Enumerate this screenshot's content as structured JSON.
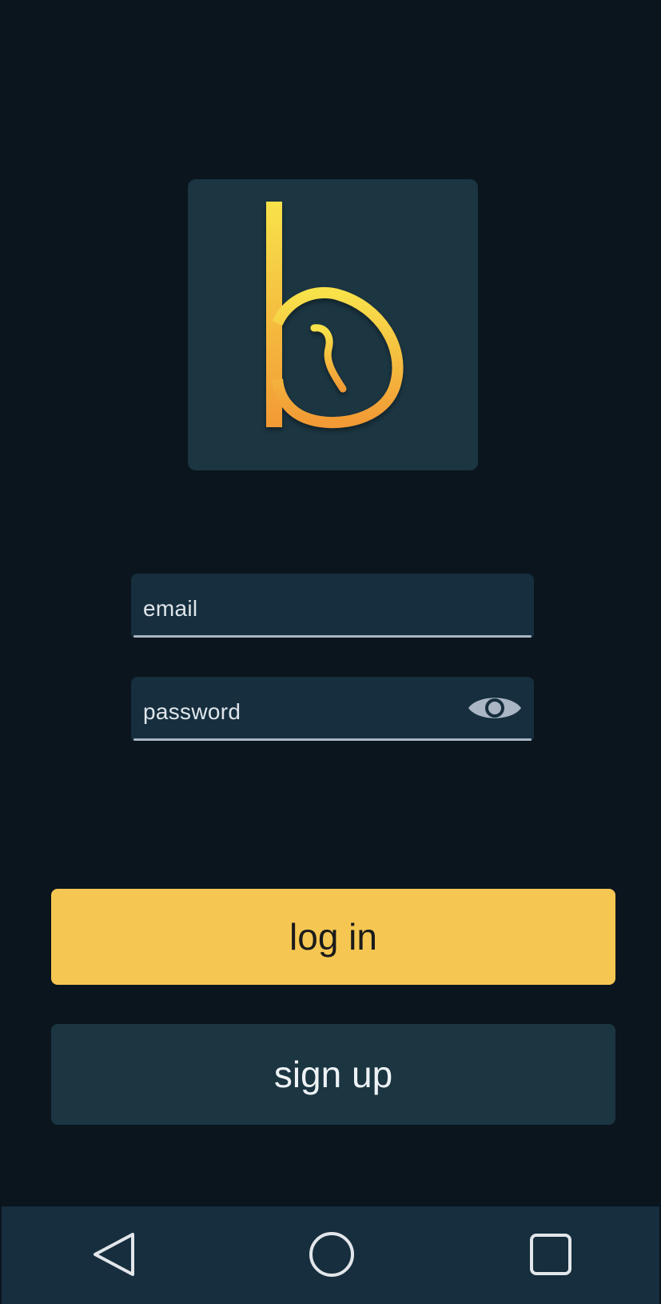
{
  "login_form": {
    "email_placeholder": "email",
    "password_placeholder": "password",
    "login_label": "log in",
    "signup_label": "sign up"
  },
  "icons": {
    "logo": "b-logo-icon",
    "password_toggle": "eye-icon",
    "nav_back": "back-triangle-icon",
    "nav_home": "home-circle-icon",
    "nav_recent": "recent-apps-square-icon"
  },
  "colors": {
    "background": "#0b151e",
    "tile": "#1b3541",
    "field": "#162e3e",
    "accent": "#f5c752",
    "logo_gradient_top": "#f8e24a",
    "logo_gradient_bottom": "#f29a35"
  }
}
